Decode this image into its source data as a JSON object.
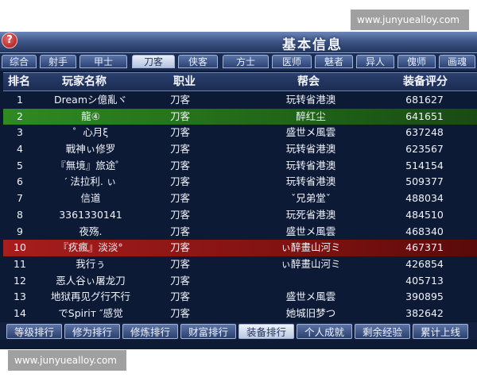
{
  "window": {
    "title": "基本信息",
    "help_label": "?"
  },
  "tabs": [
    {
      "label": "综合"
    },
    {
      "label": "射手"
    },
    {
      "label": "甲士"
    },
    {
      "label": "刀客",
      "active": true
    },
    {
      "label": "侠客"
    },
    {
      "label": "方士"
    },
    {
      "label": "医师"
    },
    {
      "label": "魅者"
    },
    {
      "label": "异人"
    },
    {
      "label": "傀师"
    },
    {
      "label": "画魂"
    }
  ],
  "columns": {
    "rank": "排名",
    "name": "玩家名称",
    "job": "职业",
    "guild": "帮会",
    "score": "装备评分"
  },
  "rows": [
    {
      "rank": "1",
      "name": "Dreamシ億亂ヾ",
      "job": "刀客",
      "guild": "玩转省港澳",
      "score": "681627"
    },
    {
      "rank": "2",
      "name": "龍④",
      "job": "刀客",
      "guild": "醉红尘",
      "score": "641651",
      "highlight": "green"
    },
    {
      "rank": "3",
      "name": "゜心月ξ",
      "job": "刀客",
      "guild": "盛世メ風雲",
      "score": "637248"
    },
    {
      "rank": "4",
      "name": "戰神ぃ修罗",
      "job": "刀客",
      "guild": "玩转省港澳",
      "score": "623567"
    },
    {
      "rank": "5",
      "name": "『無境』旅途゜",
      "job": "刀客",
      "guild": "玩转省港澳",
      "score": "514154"
    },
    {
      "rank": "6",
      "name": "′ 法拉利. ぃ",
      "job": "刀客",
      "guild": "玩转省港澳",
      "score": "509377"
    },
    {
      "rank": "7",
      "name": "信道",
      "job": "刀客",
      "guild": "ˇ兄弟堂ˇ",
      "score": "488034"
    },
    {
      "rank": "8",
      "name": "3361330141",
      "job": "刀客",
      "guild": "玩死省港澳",
      "score": "484510"
    },
    {
      "rank": "9",
      "name": "夜殇.",
      "job": "刀客",
      "guild": "盛世メ風雲",
      "score": "468340"
    },
    {
      "rank": "10",
      "name": "『疚瘋』淡淡°",
      "job": "刀客",
      "guild": "ぃ醉畫山河ミ",
      "score": "467371",
      "highlight": "red"
    },
    {
      "rank": "11",
      "name": "我行ぅ",
      "job": "刀客",
      "guild": "ぃ醉畫山河ミ",
      "score": "426854"
    },
    {
      "rank": "12",
      "name": "恶人谷ぃ屠龙刀",
      "job": "刀客",
      "guild": "",
      "score": "405713"
    },
    {
      "rank": "13",
      "name": "地狱再见グ行不行",
      "job": "刀客",
      "guild": "盛世メ風雲",
      "score": "390895"
    },
    {
      "rank": "14",
      "name": "でSpiriт ″感觉",
      "job": "刀客",
      "guild": "她城旧梦つ",
      "score": "382642"
    }
  ],
  "bottom_tabs": [
    {
      "label": "等级排行"
    },
    {
      "label": "修为排行"
    },
    {
      "label": "修炼排行"
    },
    {
      "label": "财富排行"
    },
    {
      "label": "装备排行",
      "active": true
    },
    {
      "label": "个人成就"
    },
    {
      "label": "剩余经验"
    },
    {
      "label": "累计上线"
    }
  ],
  "watermarks": {
    "top": "www.junyuealloy.com",
    "bottom": "www.junyuealloy.com"
  },
  "colors": {
    "highlight_green": "#2f8a22",
    "highlight_red": "#a81d1d",
    "background": "#0d1a36",
    "header": "#2a3f6d"
  }
}
